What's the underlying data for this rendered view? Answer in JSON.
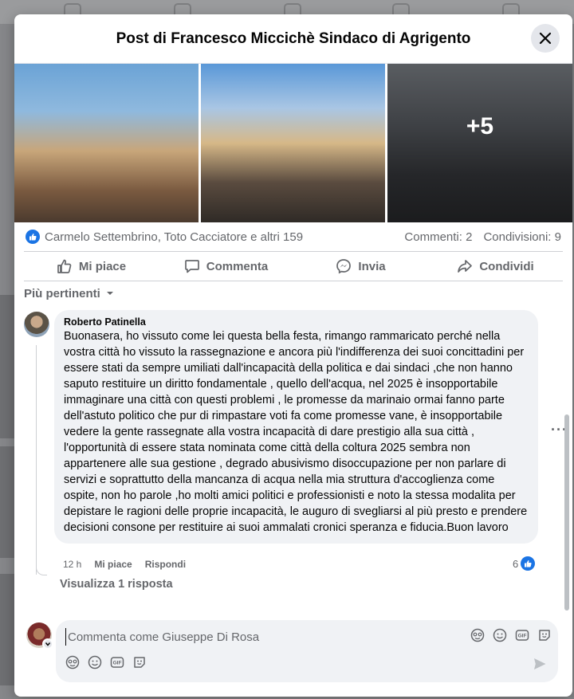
{
  "modal": {
    "title": "Post di Francesco Miccichè Sindaco di Agrigento",
    "more_photos": "+5"
  },
  "stats": {
    "reactions": "Carmelo Settembrino, Toto Cacciatore e altri 159",
    "comments": "Commenti: 2",
    "shares": "Condivisioni: 9"
  },
  "actions": [
    {
      "label": "Mi piace",
      "icon": "thumbs-up-icon"
    },
    {
      "label": "Commenta",
      "icon": "comment-icon"
    },
    {
      "label": "Invia",
      "icon": "messenger-icon"
    },
    {
      "label": "Condividi",
      "icon": "share-icon"
    }
  ],
  "filter": {
    "label": "Più pertinenti"
  },
  "comment": {
    "author": "Roberto Patinella",
    "text": "Buonasera, ho vissuto come lei questa bella festa, rimango rammaricato perché nella vostra città ho vissuto la rassegnazione e ancora più l'indifferenza dei suoi concittadini per essere stati da sempre umiliati dall'incapacità della politica e dai sindaci ,che non hanno saputo restituire un diritto fondamentale , quello dell'acqua, nel 2025 è insopportabile immaginare una città con questi problemi , le promesse da marinaio ormai fanno parte dell'astuto politico che pur di rimpastare voti fa come promesse vane, è insopportabile vedere la gente rassegnate alla vostra incapacità di dare prestigio alla sua città , l'opportunità di essere stata nominata come città della coltura 2025 sembra non appartenere alle sua gestione , degrado abusivismo disoccupazione per non parlare di servizi e soprattutto della mancanza di acqua nella mia struttura d'accoglienza come ospite, non ho parole ,ho molti amici politici e professionisti e noto la stessa modalita per depistare le ragioni delle proprie incapacità, le auguro di svegliarsi al più presto e prendere decisioni consone per restituire ai suoi ammalati cronici speranza e fiducia.Buon lavoro",
    "time": "12 h",
    "like_label": "Mi piace",
    "reply_label": "Rispondi",
    "likes": "6",
    "view_replies": "Visualizza 1 risposta"
  },
  "composer": {
    "placeholder": "Commenta come Giuseppe Di Rosa"
  },
  "colors": {
    "accent": "#1b74e4",
    "muted": "#65676b",
    "bubble": "#f0f2f5"
  }
}
